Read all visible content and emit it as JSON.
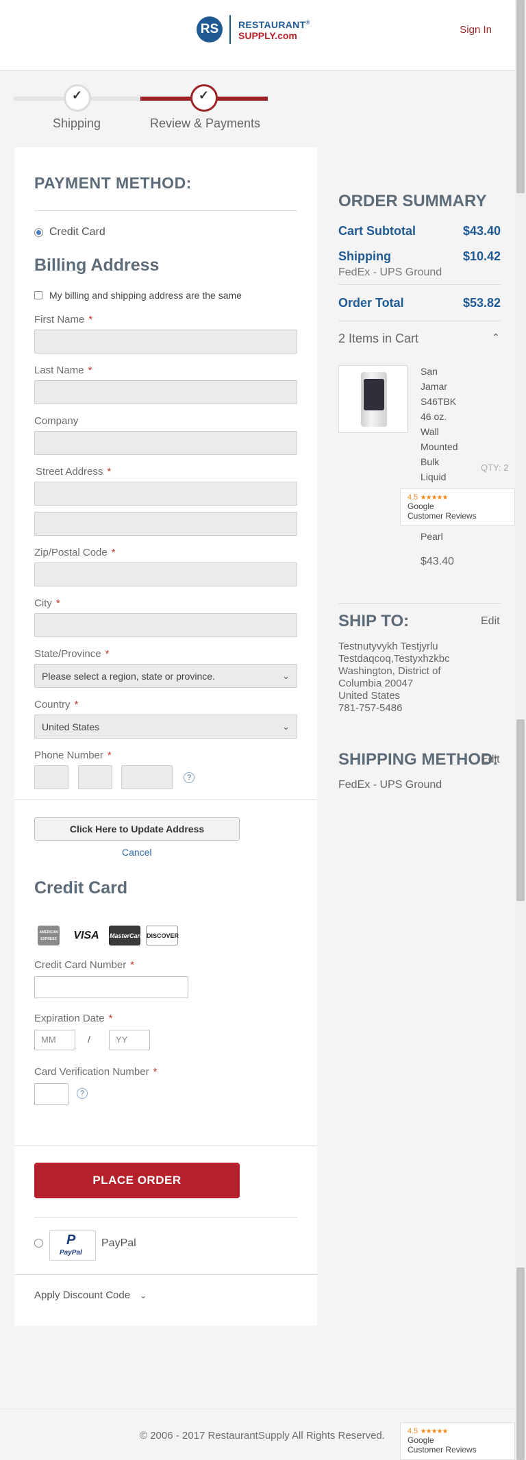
{
  "header": {
    "logo_mark": "RS",
    "logo_line1": "RESTAURANT",
    "logo_reg": "®",
    "logo_line2": "SUPPLY.com",
    "sign_in": "Sign In"
  },
  "steps": [
    {
      "label": "Shipping",
      "state": "done"
    },
    {
      "label": "Review & Payments",
      "state": "active"
    }
  ],
  "payment": {
    "title": "PAYMENT METHOD:",
    "credit_card_option": "Credit Card",
    "billing_title": "Billing Address",
    "same_address_label": "My billing and shipping address are the same",
    "first_name": "First Name",
    "last_name": "Last Name",
    "company": "Company",
    "street": "Street Address",
    "zip": "Zip/Postal Code",
    "city": "City",
    "state": "State/Province",
    "state_value": "Please select a region, state or province.",
    "country": "Country",
    "country_value": "United States",
    "phone": "Phone Number",
    "required_mark": "*",
    "help_mark": "?",
    "update_button": "Click Here to Update Address",
    "cancel": "Cancel",
    "cc_title": "Credit Card",
    "card_logos": [
      "AMERICAN EXPRESS",
      "VISA",
      "MasterCard",
      "DISCOVER"
    ],
    "cc_number": "Credit Card Number",
    "expiration": "Expiration Date",
    "mm_placeholder": "MM",
    "yy_placeholder": "YY",
    "slash": "/",
    "cvv": "Card Verification Number",
    "place_order": "PLACE ORDER",
    "paypal_label": "PayPal",
    "paypal_logo_text": "PayPal",
    "discount": "Apply Discount Code"
  },
  "summary": {
    "title": "ORDER SUMMARY",
    "cart_subtotal_label": "Cart Subtotal",
    "cart_subtotal_value": "$43.40",
    "shipping_label": "Shipping",
    "shipping_value": "$10.42",
    "shipping_method": "FedEx - UPS Ground",
    "order_total_label": "Order Total",
    "order_total_value": "$53.82",
    "items_in_cart": "2 Items in Cart",
    "product_name_lines": [
      "San",
      "Jamar",
      "S46TBK",
      "46 oz.",
      "Wall",
      "Mounted",
      "Bulk",
      "Liquid"
    ],
    "product_name_tail": "Pearl",
    "qty": "QTY: 2",
    "price": "$43.40"
  },
  "ship_to": {
    "title": "SHIP TO:",
    "edit": "Edit",
    "lines": [
      "Testnutyvykh Testjyrlu",
      "Testdaqcoq,Testyxhzkbc",
      "Washington, District of",
      "Columbia 20047",
      "United States",
      "781-757-5486"
    ]
  },
  "shipping_method": {
    "title": "SHIPPING METHOD:",
    "edit": "Edit",
    "value": "FedEx - UPS Ground"
  },
  "google_badge": {
    "rating": "4.5",
    "stars": "★★★★★",
    "line1": "Google",
    "line2": "Customer Reviews"
  },
  "footer": {
    "copyright": "© 2006 - 2017 RestaurantSupply All Rights Reserved."
  },
  "colors": {
    "brand_blue": "#1f5a93",
    "brand_red": "#b5202a",
    "step_red": "#9b2226"
  }
}
